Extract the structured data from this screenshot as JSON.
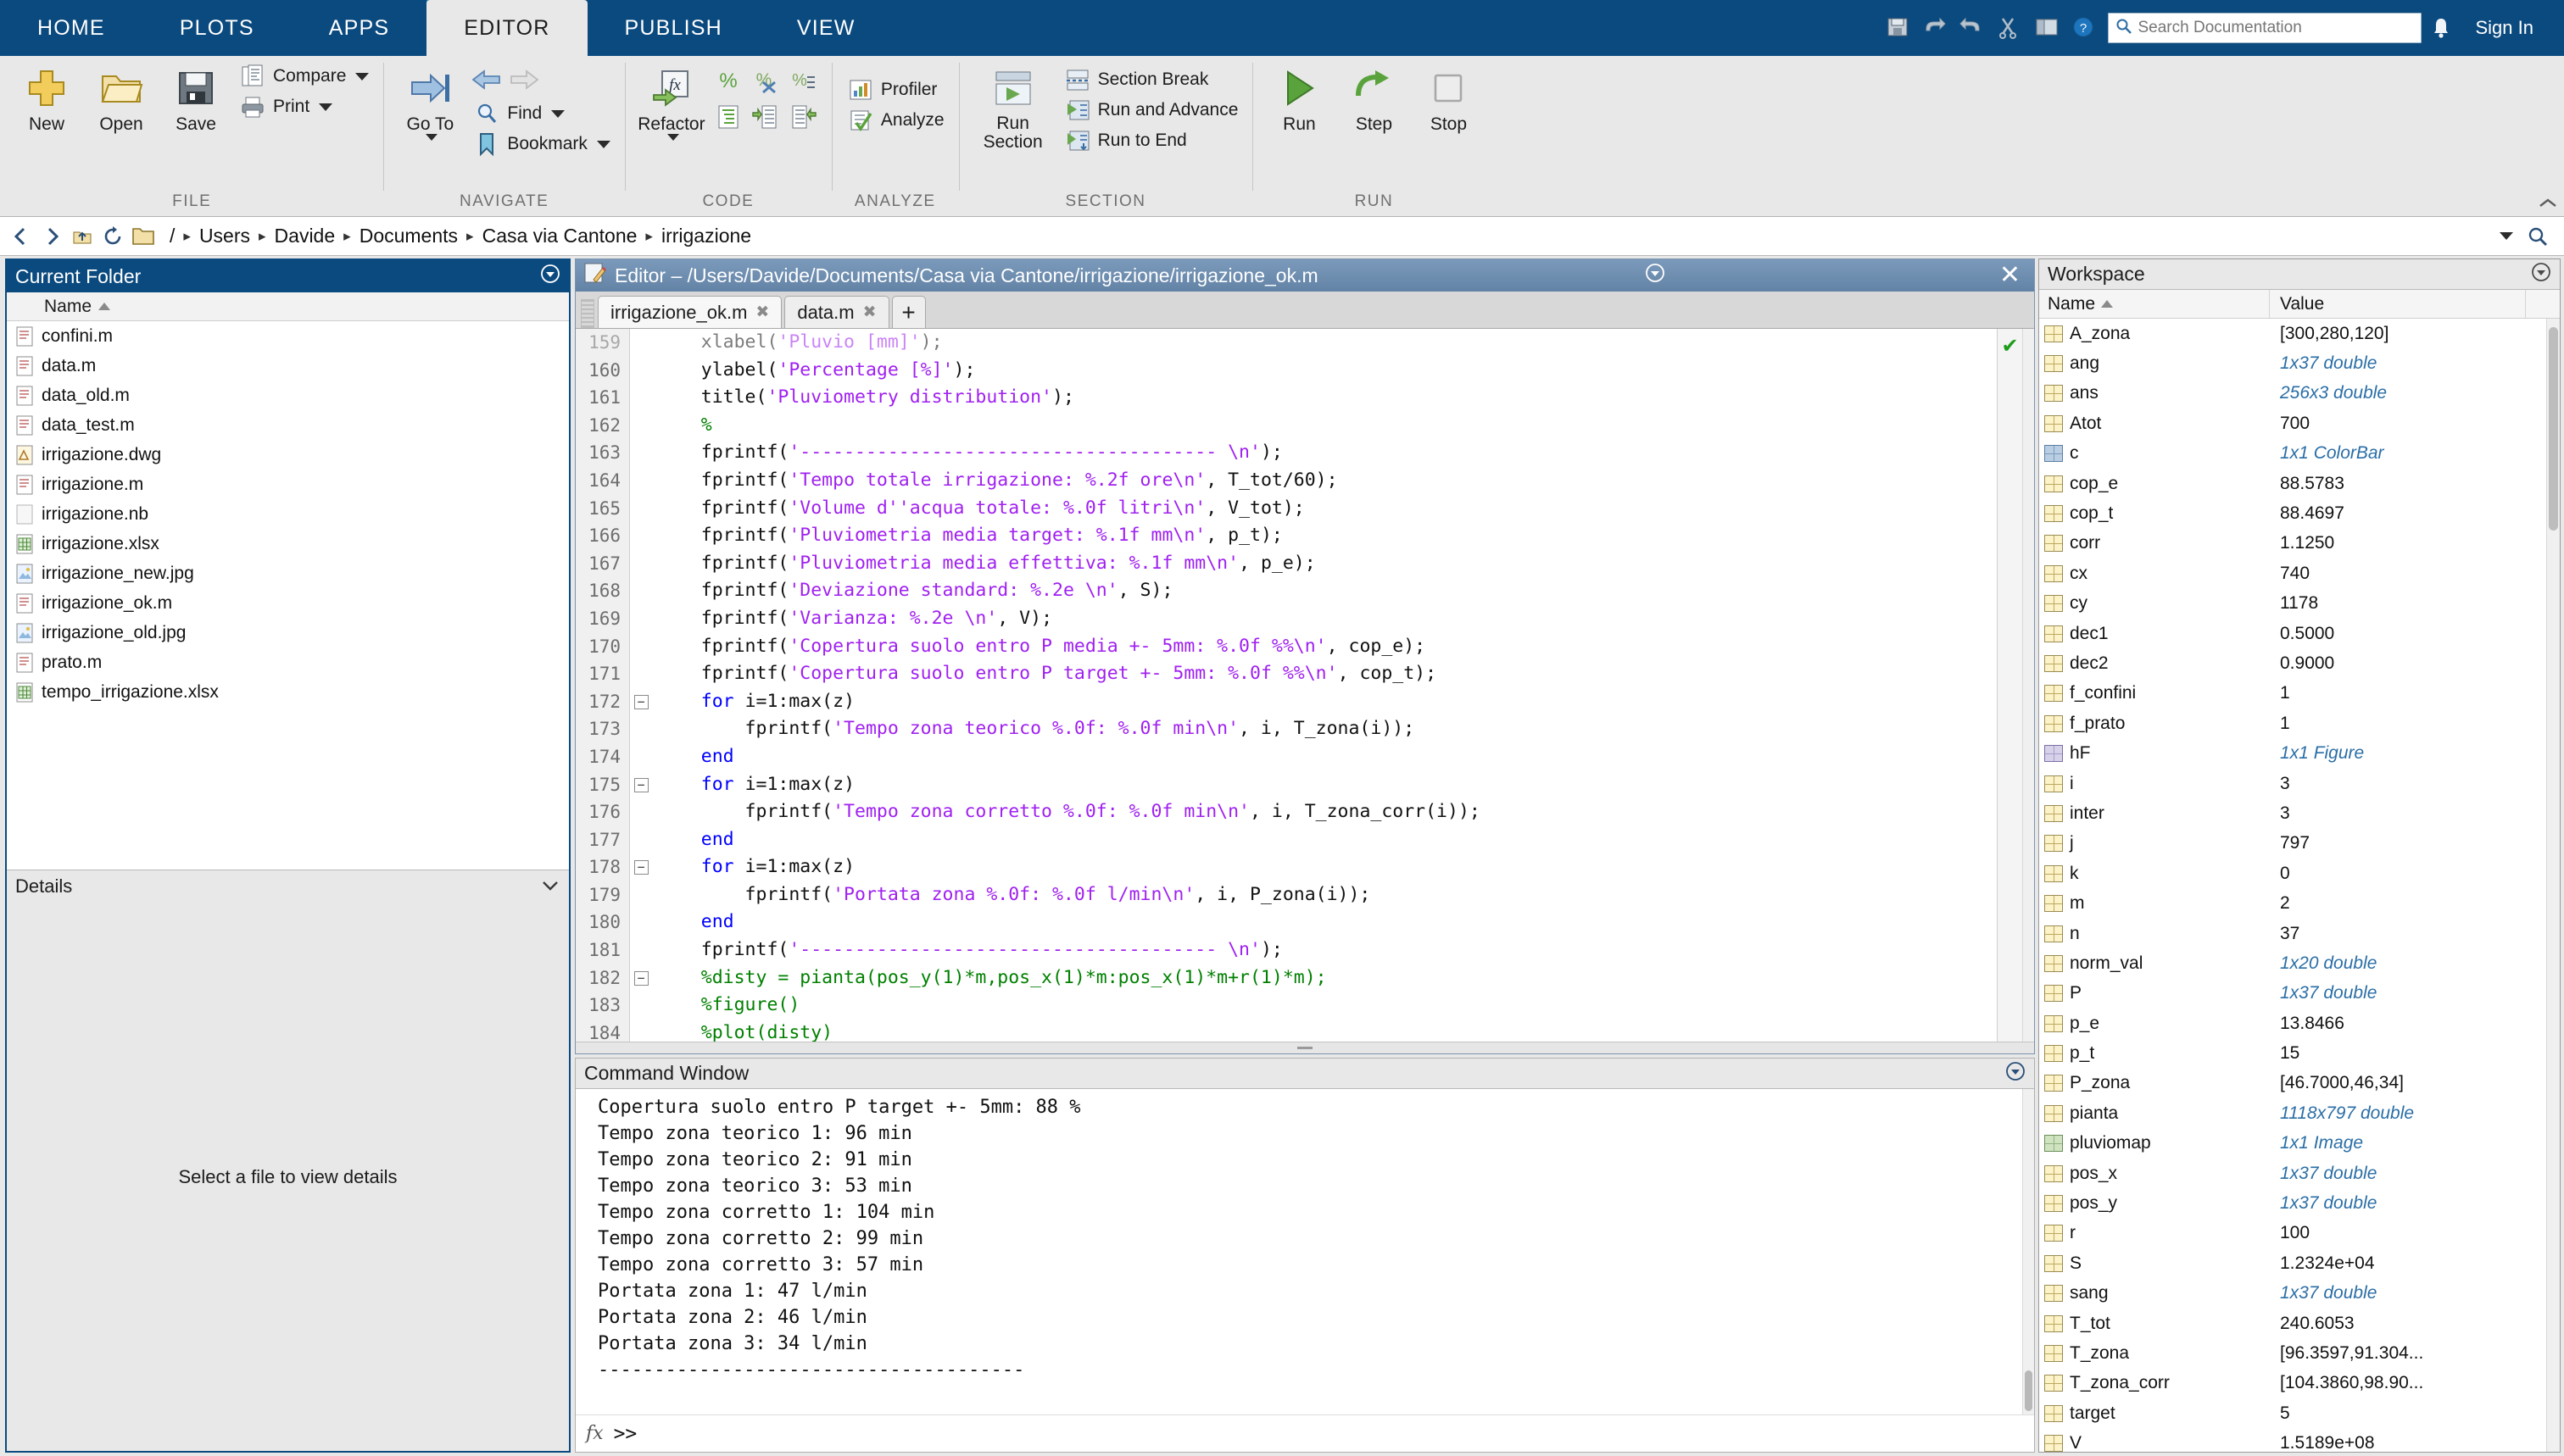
{
  "app": {
    "toolstrip_tabs": [
      "HOME",
      "PLOTS",
      "APPS",
      "EDITOR",
      "PUBLISH",
      "VIEW"
    ],
    "active_tab": "EDITOR",
    "sign_in": "Sign In",
    "search": {
      "placeholder": "Search Documentation",
      "value": ""
    },
    "quick_icons": [
      "save-icon",
      "undo-icon",
      "redo-icon",
      "cut-icon",
      "layout-icon",
      "help-icon",
      "notification-bell-icon"
    ]
  },
  "ribbon": {
    "groups": [
      {
        "label": "FILE",
        "big_buttons": [
          {
            "label": "New",
            "icon": "new-plus-icon"
          },
          {
            "label": "Open",
            "icon": "open-folder-icon"
          },
          {
            "label": "Save",
            "icon": "save-disk-icon"
          }
        ],
        "small_buttons": [
          {
            "label": "Compare",
            "icon": "compare-icon",
            "has_dropdown": true
          },
          {
            "label": "Print",
            "icon": "print-icon",
            "has_dropdown": true
          }
        ]
      },
      {
        "label": "NAVIGATE",
        "big_buttons": [
          {
            "label": "Go To",
            "icon": "goto-arrow-icon",
            "has_dropdown": true
          }
        ],
        "small_buttons": [
          {
            "label": "",
            "icon": "back-arrow-icon",
            "has_dropdown": false
          },
          {
            "label": "",
            "icon": "forward-arrow-icon",
            "has_dropdown": false
          },
          {
            "label": "Find",
            "icon": "find-magnifier-icon",
            "has_dropdown": true
          },
          {
            "label": "Bookmark",
            "icon": "bookmark-icon",
            "has_dropdown": true
          }
        ]
      },
      {
        "label": "CODE",
        "big_buttons": [
          {
            "label": "Refactor",
            "icon": "refactor-fx-icon",
            "has_dropdown": true
          }
        ],
        "small_buttons": [
          {
            "label": "",
            "icon": "comment-percent-icon"
          },
          {
            "label": "",
            "icon": "uncomment-percent-icon"
          },
          {
            "label": "",
            "icon": "wrap-comments-icon"
          },
          {
            "label": "",
            "icon": "smart-indent-icon"
          },
          {
            "label": "",
            "icon": "increase-indent-icon"
          },
          {
            "label": "",
            "icon": "decrease-indent-icon"
          }
        ]
      },
      {
        "label": "ANALYZE",
        "small_buttons": [
          {
            "label": "Profiler",
            "icon": "profiler-icon"
          },
          {
            "label": "Analyze",
            "icon": "analyze-check-icon"
          }
        ]
      },
      {
        "label": "SECTION",
        "big_buttons": [
          {
            "label": "Run Section",
            "icon": "run-section-icon"
          }
        ],
        "small_buttons": [
          {
            "label": "Section Break",
            "icon": "section-break-icon"
          },
          {
            "label": "Run and Advance",
            "icon": "run-advance-icon"
          },
          {
            "label": "Run to End",
            "icon": "run-to-end-icon"
          }
        ]
      },
      {
        "label": "RUN",
        "big_buttons": [
          {
            "label": "Run",
            "icon": "run-green-triangle-icon"
          },
          {
            "label": "Step",
            "icon": "step-icon"
          },
          {
            "label": "Stop",
            "icon": "stop-icon"
          }
        ]
      }
    ]
  },
  "pathbar": {
    "crumbs": [
      "Users",
      "Davide",
      "Documents",
      "Casa via Cantone",
      "irrigazione"
    ],
    "leading_slash": "/",
    "separator": "▸"
  },
  "current_folder": {
    "title": "Current Folder",
    "column_header": "Name",
    "files": [
      {
        "name": "confini.m",
        "icon": "m-file-icon"
      },
      {
        "name": "data.m",
        "icon": "m-file-icon"
      },
      {
        "name": "data_old.m",
        "icon": "m-file-icon"
      },
      {
        "name": "data_test.m",
        "icon": "m-file-icon"
      },
      {
        "name": "irrigazione.dwg",
        "icon": "dwg-file-icon"
      },
      {
        "name": "irrigazione.m",
        "icon": "m-file-icon"
      },
      {
        "name": "irrigazione.nb",
        "icon": "nb-file-icon"
      },
      {
        "name": "irrigazione.xlsx",
        "icon": "xlsx-file-icon"
      },
      {
        "name": "irrigazione_new.jpg",
        "icon": "jpg-file-icon"
      },
      {
        "name": "irrigazione_ok.m",
        "icon": "m-file-icon"
      },
      {
        "name": "irrigazione_old.jpg",
        "icon": "jpg-file-icon"
      },
      {
        "name": "prato.m",
        "icon": "m-file-icon"
      },
      {
        "name": "tempo_irrigazione.xlsx",
        "icon": "xlsx-file-icon"
      }
    ],
    "details_label": "Details",
    "details_placeholder": "Select a file to view details"
  },
  "editor": {
    "window_title": "Editor – /Users/Davide/Documents/Casa via Cantone/irrigazione/irrigazione_ok.m",
    "tabs": [
      {
        "label": "irrigazione_ok.m",
        "active": true
      },
      {
        "label": "data.m",
        "active": false
      }
    ],
    "new_tab_label": "+",
    "status_icon": "green-check-icon",
    "lines": [
      {
        "n": "159",
        "fold": "",
        "tokens": [
          {
            "t": "    xlabel(",
            "c": "plain"
          },
          {
            "t": "'Pluvio [mm]'",
            "c": "str"
          },
          {
            "t": ");",
            "c": "plain"
          }
        ]
      },
      {
        "n": "160",
        "fold": "",
        "tokens": [
          {
            "t": "    ylabel(",
            "c": "plain"
          },
          {
            "t": "'Percentage [%]'",
            "c": "str"
          },
          {
            "t": ");",
            "c": "plain"
          }
        ]
      },
      {
        "n": "161",
        "fold": "",
        "tokens": [
          {
            "t": "    title(",
            "c": "plain"
          },
          {
            "t": "'Pluviometry distribution'",
            "c": "str"
          },
          {
            "t": ");",
            "c": "plain"
          }
        ]
      },
      {
        "n": "162",
        "fold": "",
        "tokens": [
          {
            "t": "    %",
            "c": "cmt"
          }
        ]
      },
      {
        "n": "163",
        "fold": "",
        "tokens": [
          {
            "t": "    fprintf(",
            "c": "plain"
          },
          {
            "t": "'-------------------------------------- \\n'",
            "c": "str"
          },
          {
            "t": ");",
            "c": "plain"
          }
        ]
      },
      {
        "n": "164",
        "fold": "",
        "tokens": [
          {
            "t": "    fprintf(",
            "c": "plain"
          },
          {
            "t": "'Tempo totale irrigazione: %.2f ore\\n'",
            "c": "str"
          },
          {
            "t": ", T_tot/60);",
            "c": "plain"
          }
        ]
      },
      {
        "n": "165",
        "fold": "",
        "tokens": [
          {
            "t": "    fprintf(",
            "c": "plain"
          },
          {
            "t": "'Volume d''acqua totale: %.0f litri\\n'",
            "c": "str"
          },
          {
            "t": ", V_tot);",
            "c": "plain"
          }
        ]
      },
      {
        "n": "166",
        "fold": "",
        "tokens": [
          {
            "t": "    fprintf(",
            "c": "plain"
          },
          {
            "t": "'Pluviometria media target: %.1f mm\\n'",
            "c": "str"
          },
          {
            "t": ", p_t);",
            "c": "plain"
          }
        ]
      },
      {
        "n": "167",
        "fold": "",
        "tokens": [
          {
            "t": "    fprintf(",
            "c": "plain"
          },
          {
            "t": "'Pluviometria media effettiva: %.1f mm\\n'",
            "c": "str"
          },
          {
            "t": ", p_e);",
            "c": "plain"
          }
        ]
      },
      {
        "n": "168",
        "fold": "",
        "tokens": [
          {
            "t": "    fprintf(",
            "c": "plain"
          },
          {
            "t": "'Deviazione standard: %.2e \\n'",
            "c": "str"
          },
          {
            "t": ", S);",
            "c": "plain"
          }
        ]
      },
      {
        "n": "169",
        "fold": "",
        "tokens": [
          {
            "t": "    fprintf(",
            "c": "plain"
          },
          {
            "t": "'Varianza: %.2e \\n'",
            "c": "str"
          },
          {
            "t": ", V);",
            "c": "plain"
          }
        ]
      },
      {
        "n": "170",
        "fold": "",
        "tokens": [
          {
            "t": "    fprintf(",
            "c": "plain"
          },
          {
            "t": "'Copertura suolo entro P media +- 5mm: %.0f %%\\n'",
            "c": "str"
          },
          {
            "t": ", cop_e);",
            "c": "plain"
          }
        ]
      },
      {
        "n": "171",
        "fold": "",
        "tokens": [
          {
            "t": "    fprintf(",
            "c": "plain"
          },
          {
            "t": "'Copertura suolo entro P target +- 5mm: %.0f %%\\n'",
            "c": "str"
          },
          {
            "t": ", cop_t);",
            "c": "plain"
          }
        ]
      },
      {
        "n": "172",
        "fold": "−",
        "tokens": [
          {
            "t": "    ",
            "c": "plain"
          },
          {
            "t": "for",
            "c": "kw"
          },
          {
            "t": " i=1:max(z)",
            "c": "plain"
          }
        ]
      },
      {
        "n": "173",
        "fold": "",
        "tokens": [
          {
            "t": "        fprintf(",
            "c": "plain"
          },
          {
            "t": "'Tempo zona teorico %.0f: %.0f min\\n'",
            "c": "str"
          },
          {
            "t": ", i, T_zona(i));",
            "c": "plain"
          }
        ]
      },
      {
        "n": "174",
        "fold": "",
        "tokens": [
          {
            "t": "    ",
            "c": "plain"
          },
          {
            "t": "end",
            "c": "kw"
          }
        ]
      },
      {
        "n": "175",
        "fold": "−",
        "tokens": [
          {
            "t": "    ",
            "c": "plain"
          },
          {
            "t": "for",
            "c": "kw"
          },
          {
            "t": " i=1:max(z)",
            "c": "plain"
          }
        ]
      },
      {
        "n": "176",
        "fold": "",
        "tokens": [
          {
            "t": "        fprintf(",
            "c": "plain"
          },
          {
            "t": "'Tempo zona corretto %.0f: %.0f min\\n'",
            "c": "str"
          },
          {
            "t": ", i, T_zona_corr(i));",
            "c": "plain"
          }
        ]
      },
      {
        "n": "177",
        "fold": "",
        "tokens": [
          {
            "t": "    ",
            "c": "plain"
          },
          {
            "t": "end",
            "c": "kw"
          }
        ]
      },
      {
        "n": "178",
        "fold": "−",
        "tokens": [
          {
            "t": "    ",
            "c": "plain"
          },
          {
            "t": "for",
            "c": "kw"
          },
          {
            "t": " i=1:max(z)",
            "c": "plain"
          }
        ]
      },
      {
        "n": "179",
        "fold": "",
        "tokens": [
          {
            "t": "        fprintf(",
            "c": "plain"
          },
          {
            "t": "'Portata zona %.0f: %.0f l/min\\n'",
            "c": "str"
          },
          {
            "t": ", i, P_zona(i));",
            "c": "plain"
          }
        ]
      },
      {
        "n": "180",
        "fold": "",
        "tokens": [
          {
            "t": "    ",
            "c": "plain"
          },
          {
            "t": "end",
            "c": "kw"
          }
        ]
      },
      {
        "n": "181",
        "fold": "",
        "tokens": [
          {
            "t": "    fprintf(",
            "c": "plain"
          },
          {
            "t": "'-------------------------------------- \\n'",
            "c": "str"
          },
          {
            "t": ");",
            "c": "plain"
          }
        ]
      },
      {
        "n": "182",
        "fold": "−",
        "tokens": [
          {
            "t": "    %disty = pianta(pos_y(1)*m,pos_x(1)*m:pos_x(1)*m+r(1)*m);",
            "c": "cmt"
          }
        ]
      },
      {
        "n": "183",
        "fold": "",
        "tokens": [
          {
            "t": "    %figure()",
            "c": "cmt"
          }
        ]
      },
      {
        "n": "184",
        "fold": "",
        "tokens": [
          {
            "t": "    %plot(disty)",
            "c": "cmt"
          }
        ]
      }
    ]
  },
  "command_window": {
    "title": "Command Window",
    "output": [
      "Copertura suolo entro P target +- 5mm: 88 %",
      "Tempo zona teorico 1: 96 min",
      "Tempo zona teorico 2: 91 min",
      "Tempo zona teorico 3: 53 min",
      "Tempo zona corretto 1: 104 min",
      "Tempo zona corretto 2: 99 min",
      "Tempo zona corretto 3: 57 min",
      "Portata zona 1: 47 l/min",
      "Portata zona 2: 46 l/min",
      "Portata zona 3: 34 l/min",
      "--------------------------------------"
    ],
    "prompt": ">>",
    "prompt_icon": "fx-icon"
  },
  "workspace": {
    "title": "Workspace",
    "columns": [
      "Name",
      "Value"
    ],
    "sort_column": "Name",
    "variables": [
      {
        "name": "A_zona",
        "value": "[300,280,120]",
        "italic": false,
        "icon": "matrix-icon"
      },
      {
        "name": "ang",
        "value": "1x37 double",
        "italic": true,
        "icon": "matrix-icon"
      },
      {
        "name": "ans",
        "value": "256x3 double",
        "italic": true,
        "icon": "matrix-icon"
      },
      {
        "name": "Atot",
        "value": "700",
        "italic": false,
        "icon": "matrix-icon"
      },
      {
        "name": "c",
        "value": "1x1 ColorBar",
        "italic": true,
        "icon": "object-icon"
      },
      {
        "name": "cop_e",
        "value": "88.5783",
        "italic": false,
        "icon": "matrix-icon"
      },
      {
        "name": "cop_t",
        "value": "88.4697",
        "italic": false,
        "icon": "matrix-icon"
      },
      {
        "name": "corr",
        "value": "1.1250",
        "italic": false,
        "icon": "matrix-icon"
      },
      {
        "name": "cx",
        "value": "740",
        "italic": false,
        "icon": "matrix-icon"
      },
      {
        "name": "cy",
        "value": "1178",
        "italic": false,
        "icon": "matrix-icon"
      },
      {
        "name": "dec1",
        "value": "0.5000",
        "italic": false,
        "icon": "matrix-icon"
      },
      {
        "name": "dec2",
        "value": "0.9000",
        "italic": false,
        "icon": "matrix-icon"
      },
      {
        "name": "f_confini",
        "value": "1",
        "italic": false,
        "icon": "matrix-icon"
      },
      {
        "name": "f_prato",
        "value": "1",
        "italic": false,
        "icon": "matrix-icon"
      },
      {
        "name": "hF",
        "value": "1x1 Figure",
        "italic": true,
        "icon": "figure-icon"
      },
      {
        "name": "i",
        "value": "3",
        "italic": false,
        "icon": "matrix-icon"
      },
      {
        "name": "inter",
        "value": "3",
        "italic": false,
        "icon": "matrix-icon"
      },
      {
        "name": "j",
        "value": "797",
        "italic": false,
        "icon": "matrix-icon"
      },
      {
        "name": "k",
        "value": "0",
        "italic": false,
        "icon": "matrix-icon"
      },
      {
        "name": "m",
        "value": "2",
        "italic": false,
        "icon": "matrix-icon"
      },
      {
        "name": "n",
        "value": "37",
        "italic": false,
        "icon": "matrix-icon"
      },
      {
        "name": "norm_val",
        "value": "1x20 double",
        "italic": true,
        "icon": "matrix-icon"
      },
      {
        "name": "P",
        "value": "1x37 double",
        "italic": true,
        "icon": "matrix-icon"
      },
      {
        "name": "p_e",
        "value": "13.8466",
        "italic": false,
        "icon": "matrix-icon"
      },
      {
        "name": "p_t",
        "value": "15",
        "italic": false,
        "icon": "matrix-icon"
      },
      {
        "name": "P_zona",
        "value": "[46.7000,46,34]",
        "italic": false,
        "icon": "matrix-icon"
      },
      {
        "name": "pianta",
        "value": "1118x797 double",
        "italic": true,
        "icon": "matrix-icon"
      },
      {
        "name": "pluviomap",
        "value": "1x1 Image",
        "italic": true,
        "icon": "image-icon"
      },
      {
        "name": "pos_x",
        "value": "1x37 double",
        "italic": true,
        "icon": "matrix-icon"
      },
      {
        "name": "pos_y",
        "value": "1x37 double",
        "italic": true,
        "icon": "matrix-icon"
      },
      {
        "name": "r",
        "value": "100",
        "italic": false,
        "icon": "matrix-icon"
      },
      {
        "name": "S",
        "value": "1.2324e+04",
        "italic": false,
        "icon": "matrix-icon"
      },
      {
        "name": "sang",
        "value": "1x37 double",
        "italic": true,
        "icon": "matrix-icon"
      },
      {
        "name": "T_tot",
        "value": "240.6053",
        "italic": false,
        "icon": "matrix-icon"
      },
      {
        "name": "T_zona",
        "value": "[96.3597,91.304...",
        "italic": false,
        "icon": "matrix-icon"
      },
      {
        "name": "T_zona_corr",
        "value": "[104.3860,98.90...",
        "italic": false,
        "icon": "matrix-icon"
      },
      {
        "name": "target",
        "value": "5",
        "italic": false,
        "icon": "matrix-icon"
      },
      {
        "name": "V",
        "value": "1.5189e+08",
        "italic": false,
        "icon": "matrix-icon"
      }
    ]
  },
  "colors": {
    "toolstrip_blue": "#0b4a7f",
    "tab_accent": "#1a7fc1",
    "editor_title_bar": "#6e8fae",
    "panel_selected": "#0b4a7f",
    "string_purple": "#a020f0",
    "keyword_blue": "#0000ff",
    "comment_green": "#008000",
    "value_italic_blue": "#2a6ea6"
  }
}
